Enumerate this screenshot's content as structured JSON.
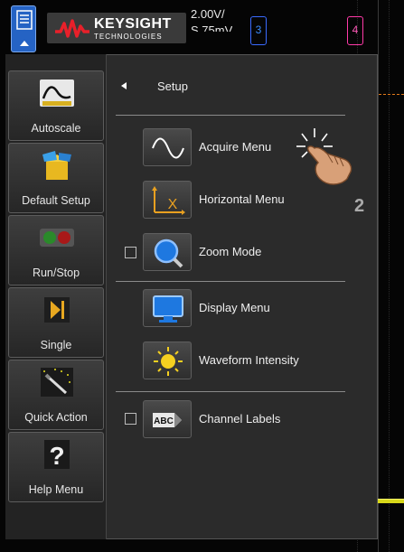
{
  "header": {
    "brand": "KEYSIGHT",
    "brand_sub": "TECHNOLOGIES",
    "volt_line1": "2.00V/",
    "volt_line2": "S 75mV",
    "channel3": "3",
    "channel4": "4"
  },
  "left_buttons": [
    {
      "label": "Autoscale",
      "icon": "autoscale-icon"
    },
    {
      "label": "Default Setup",
      "icon": "default-setup-icon"
    },
    {
      "label": "Run/Stop",
      "icon": "run-stop-icon"
    },
    {
      "label": "Single",
      "icon": "single-icon"
    },
    {
      "label": "Quick Action",
      "icon": "quick-action-icon"
    },
    {
      "label": "Help Menu",
      "icon": "help-icon"
    }
  ],
  "setup": {
    "title": "Setup",
    "items": [
      {
        "label": "Acquire Menu",
        "icon": "acquire-icon",
        "checkbox": false
      },
      {
        "label": "Horizontal Menu",
        "icon": "horizontal-icon",
        "checkbox": false
      },
      {
        "label": "Zoom Mode",
        "icon": "zoom-icon",
        "checkbox": true,
        "checked": false
      },
      {
        "label": "Display Menu",
        "icon": "display-icon",
        "checkbox": false
      },
      {
        "label": "Waveform Intensity",
        "icon": "intensity-icon",
        "checkbox": false
      },
      {
        "label": "Channel Labels",
        "icon": "channel-labels-icon",
        "checkbox": true,
        "checked": false
      }
    ]
  },
  "annotation": {
    "step": "2"
  },
  "colors": {
    "accent_blue": "#2563c4",
    "channel3": "#3a8bff",
    "channel4": "#ff5ab8",
    "trace_yellow": "#d8d81a",
    "trace_orange": "#e07a1a"
  }
}
